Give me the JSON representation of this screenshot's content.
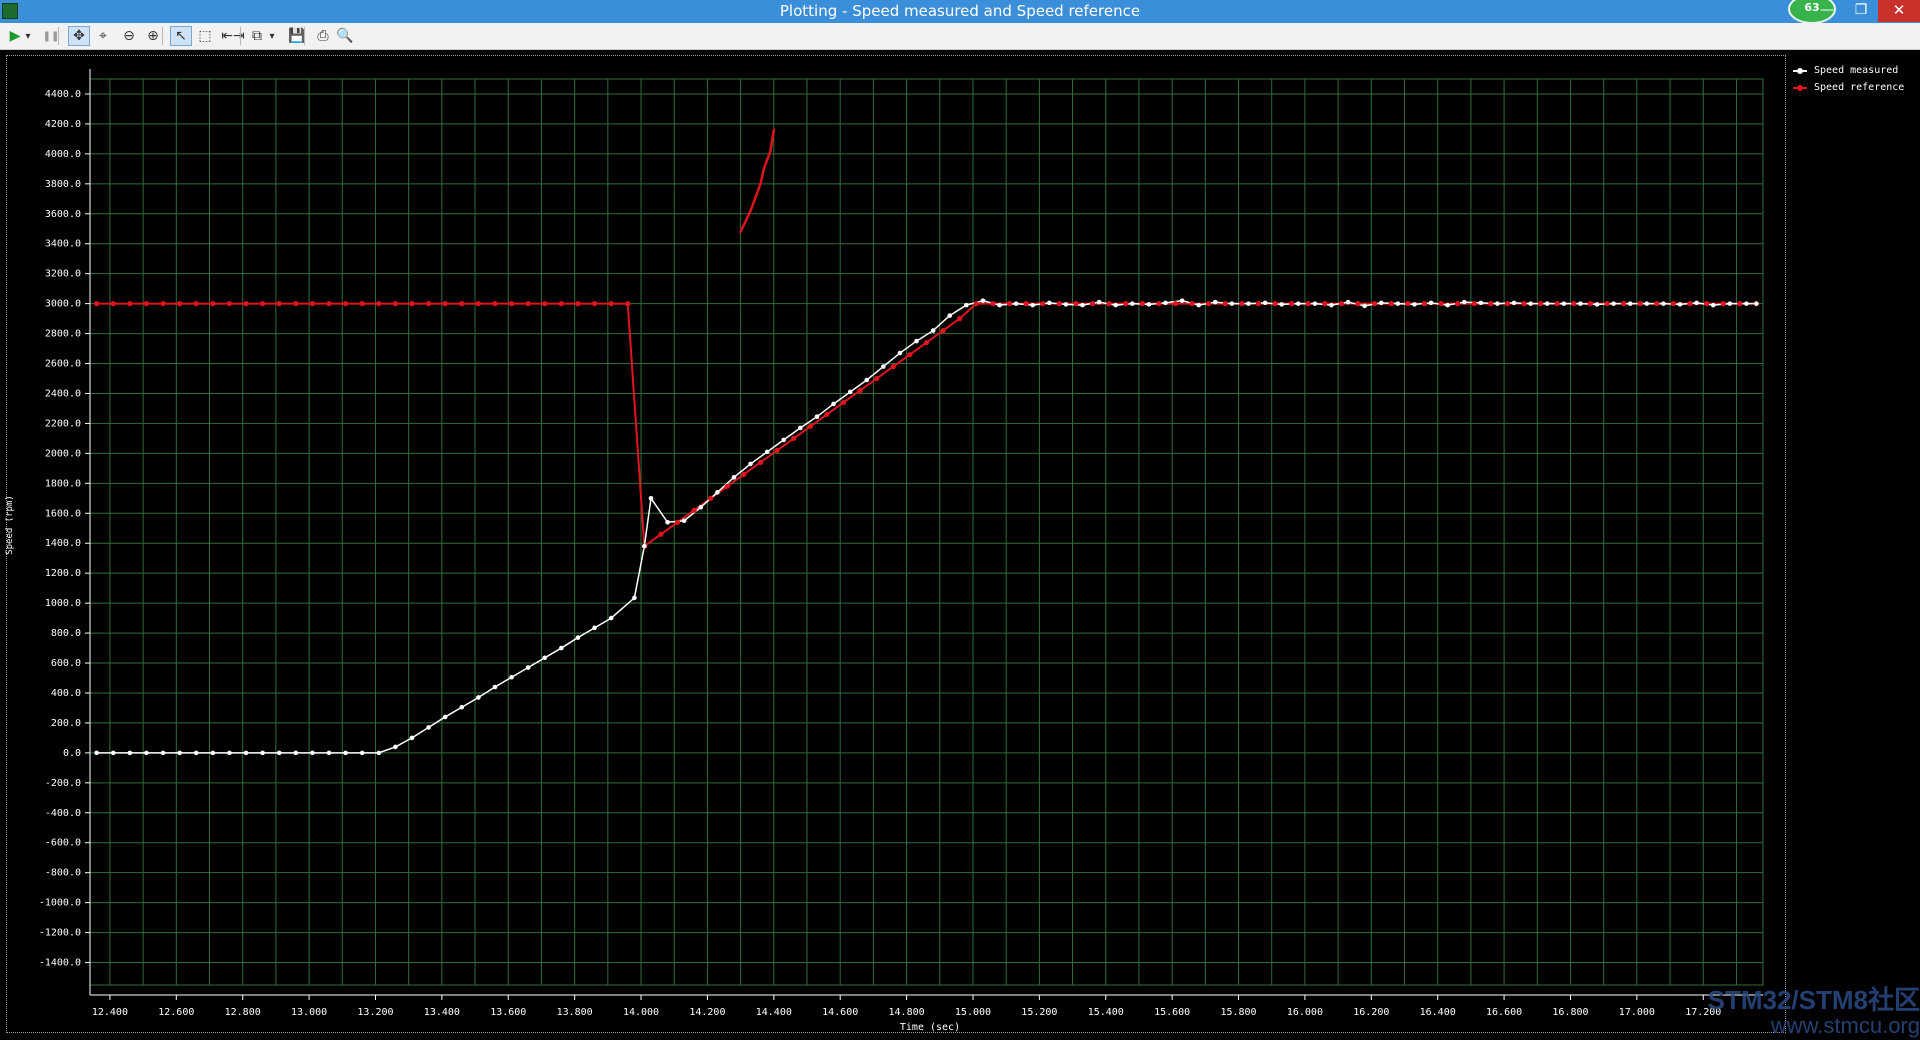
{
  "window": {
    "title": "Plotting  - Speed measured and Speed reference",
    "badge_count": "63",
    "minimize_glyph": "—",
    "maximize_glyph": "❐",
    "close_glyph": "✕"
  },
  "toolbar": {
    "buttons": [
      {
        "name": "run-icon",
        "glyph": "▶"
      },
      {
        "name": "run-dropdown-icon",
        "glyph": "▾"
      },
      {
        "name": "pause-icon",
        "glyph": "❚❚"
      },
      {
        "name": "pan-icon",
        "glyph": "✥"
      },
      {
        "name": "zoom-fit-icon",
        "glyph": "⌖"
      },
      {
        "name": "zoom-out-icon",
        "glyph": "⊖"
      },
      {
        "name": "zoom-in-icon",
        "glyph": "⊕"
      },
      {
        "name": "select-pointer-icon",
        "glyph": "↖"
      },
      {
        "name": "select-rect-icon",
        "glyph": "⬚"
      },
      {
        "name": "cursor-measure-icon",
        "glyph": "⇤⇥"
      },
      {
        "name": "copy-icon",
        "glyph": "⧉"
      },
      {
        "name": "copy-dropdown-icon",
        "glyph": "▾"
      },
      {
        "name": "save-icon",
        "glyph": "💾"
      },
      {
        "name": "print-icon",
        "glyph": "⎙"
      },
      {
        "name": "print-preview-icon",
        "glyph": "🔍"
      }
    ]
  },
  "colors": {
    "measured": "#ffffff",
    "reference": "#e0141e",
    "grid": "#2f6e3a",
    "background": "#000000",
    "axis": "#ffffff"
  },
  "legend": {
    "measured_label": "Speed measured",
    "reference_label": "Speed reference"
  },
  "axes": {
    "x_title": "Time (sec)",
    "y_title": "Speed (rpm)"
  },
  "watermark": {
    "line1": "STM32/STM8社区",
    "line2": "www.stmcu.org"
  },
  "chart_data": {
    "type": "line",
    "xlabel": "Time (sec)",
    "ylabel": "Speed (rpm)",
    "xlim": [
      12.34,
      17.38
    ],
    "ylim": [
      -1550,
      4500
    ],
    "x_ticks": [
      12.4,
      12.6,
      12.8,
      13.0,
      13.2,
      13.4,
      13.6,
      13.8,
      14.0,
      14.2,
      14.4,
      14.6,
      14.8,
      15.0,
      15.2,
      15.4,
      15.6,
      15.8,
      16.0,
      16.2,
      16.4,
      16.6,
      16.8,
      17.0,
      17.2
    ],
    "x_tick_labels": [
      "12.400",
      "12.600",
      "12.800",
      "13.000",
      "13.200",
      "13.400",
      "13.600",
      "13.800",
      "14.000",
      "14.200",
      "14.400",
      "14.600",
      "14.800",
      "15.000",
      "15.200",
      "15.400",
      "15.600",
      "15.800",
      "16.000",
      "16.200",
      "16.400",
      "16.600",
      "16.800",
      "17.000",
      "17.200"
    ],
    "y_ticks": [
      4400,
      4200,
      4000,
      3800,
      3600,
      3400,
      3200,
      3000,
      2800,
      2600,
      2400,
      2200,
      2000,
      1800,
      1600,
      1400,
      1200,
      1000,
      800,
      600,
      400,
      200,
      0,
      -200,
      -400,
      -600,
      -800,
      -1000,
      -1200,
      -1400
    ],
    "y_tick_labels": [
      "4400.0",
      "4200.0",
      "4000.0",
      "3800.0",
      "3600.0",
      "3400.0",
      "3200.0",
      "3000.0",
      "2800.0",
      "2600.0",
      "2400.0",
      "2200.0",
      "2000.0",
      "1800.0",
      "1600.0",
      "1400.0",
      "1200.0",
      "1000.0",
      "800.0",
      "600.0",
      "400.0",
      "200.0",
      "0.0",
      "-200.0",
      "-400.0",
      "-600.0",
      "-800.0",
      "-1000.0",
      "-1200.0",
      "-1400.0"
    ],
    "grid": true,
    "legend_position": "top-right",
    "series": [
      {
        "name": "Speed measured",
        "x": [
          12.36,
          12.41,
          12.46,
          12.51,
          12.56,
          12.61,
          12.66,
          12.71,
          12.76,
          12.81,
          12.86,
          12.91,
          12.96,
          13.01,
          13.06,
          13.11,
          13.16,
          13.21,
          13.26,
          13.31,
          13.36,
          13.41,
          13.46,
          13.51,
          13.56,
          13.61,
          13.66,
          13.71,
          13.76,
          13.81,
          13.86,
          13.91,
          13.98,
          14.01,
          14.03,
          14.08,
          14.13,
          14.18,
          14.23,
          14.28,
          14.33,
          14.38,
          14.43,
          14.48,
          14.53,
          14.58,
          14.63,
          14.68,
          14.73,
          14.78,
          14.83,
          14.88,
          14.93,
          14.98,
          15.03,
          15.08,
          15.13,
          15.18,
          15.23,
          15.28,
          15.33,
          15.38,
          15.43,
          15.48,
          15.53,
          15.58,
          15.63,
          15.68,
          15.73,
          15.78,
          15.83,
          15.88,
          15.93,
          15.98,
          16.03,
          16.08,
          16.13,
          16.18,
          16.23,
          16.28,
          16.33,
          16.38,
          16.43,
          16.48,
          16.53,
          16.58,
          16.63,
          16.68,
          16.73,
          16.78,
          16.83,
          16.88,
          16.93,
          16.98,
          17.03,
          17.08,
          17.13,
          17.18,
          17.23,
          17.28,
          17.33,
          17.36
        ],
        "y": [
          0,
          0,
          0,
          0,
          0,
          0,
          0,
          0,
          0,
          0,
          0,
          0,
          0,
          0,
          0,
          0,
          0,
          0,
          40,
          100,
          170,
          240,
          305,
          370,
          440,
          505,
          570,
          635,
          700,
          770,
          835,
          900,
          1035,
          1380,
          1700,
          1540,
          1550,
          1640,
          1740,
          1840,
          1930,
          2010,
          2090,
          2170,
          2245,
          2330,
          2410,
          2490,
          2580,
          2670,
          2750,
          2820,
          2920,
          2990,
          3020,
          2990,
          3000,
          2990,
          3005,
          2995,
          2990,
          3010,
          2990,
          3000,
          2995,
          3005,
          3020,
          2990,
          3010,
          3000,
          3000,
          3005,
          2995,
          3000,
          3000,
          2990,
          3010,
          2985,
          3005,
          3000,
          2995,
          3005,
          2990,
          3010,
          3005,
          3000,
          3005,
          3000,
          3000,
          3000,
          3000,
          2995,
          3000,
          3000,
          3000,
          3000,
          2995,
          3005,
          2990,
          3000,
          3000,
          3000
        ]
      },
      {
        "name": "Speed reference",
        "x": [
          12.36,
          12.41,
          12.46,
          12.51,
          12.56,
          12.61,
          12.66,
          12.71,
          12.76,
          12.81,
          12.86,
          12.91,
          12.96,
          13.01,
          13.06,
          13.11,
          13.16,
          13.21,
          13.26,
          13.31,
          13.36,
          13.41,
          13.46,
          13.51,
          13.56,
          13.61,
          13.66,
          13.71,
          13.76,
          13.81,
          13.86,
          13.91,
          13.96,
          14.01,
          14.06,
          14.11,
          14.16,
          14.21,
          14.26,
          14.31,
          14.36,
          14.41,
          14.46,
          14.51,
          14.56,
          14.61,
          14.66,
          14.71,
          14.76,
          14.81,
          14.86,
          14.91,
          14.96,
          15.01,
          15.06,
          15.11,
          15.16,
          15.21,
          15.26,
          15.31,
          15.36,
          15.41,
          15.46,
          15.51,
          15.56,
          15.61,
          15.66,
          15.71,
          15.76,
          15.81,
          15.86,
          15.91,
          15.96,
          16.01,
          16.06,
          16.11,
          16.16,
          16.21,
          16.26,
          16.31,
          16.36,
          16.41,
          16.46,
          16.51,
          16.56,
          16.61,
          16.66,
          16.71,
          16.76,
          16.81,
          16.86,
          16.91,
          16.96,
          17.01,
          17.06,
          17.11,
          17.16,
          17.21,
          17.26,
          17.31,
          17.36
        ],
        "y": [
          3000,
          3000,
          3000,
          3000,
          3000,
          3000,
          3000,
          3000,
          3000,
          3000,
          3000,
          3000,
          3000,
          3000,
          3000,
          3000,
          3000,
          3000,
          3000,
          3000,
          3000,
          3000,
          3000,
          3000,
          3000,
          3000,
          3000,
          3000,
          3000,
          3000,
          3000,
          3000,
          3000,
          1380,
          1460,
          1540,
          1620,
          1700,
          1780,
          1860,
          1940,
          2020,
          2100,
          2180,
          2260,
          2340,
          2420,
          2500,
          2580,
          2660,
          2740,
          2820,
          2900,
          3000,
          3000,
          3000,
          3000,
          3000,
          3000,
          3000,
          3000,
          3000,
          3000,
          3000,
          3000,
          3000,
          3000,
          3000,
          3000,
          3000,
          3000,
          3000,
          3000,
          3000,
          3000,
          3000,
          3000,
          3000,
          3000,
          3000,
          3000,
          3000,
          3000,
          3000,
          3000,
          3000,
          3000,
          3000,
          3000,
          3000,
          3000,
          3000,
          3000,
          3000,
          3000,
          3000,
          3000,
          3000,
          3000,
          3000,
          3000
        ]
      }
    ],
    "annotation_stroke": {
      "color": "#e0141e",
      "x": [
        14.3,
        14.33,
        14.36,
        14.37,
        14.39,
        14.4
      ],
      "y": [
        3480,
        3620,
        3800,
        3900,
        4020,
        4160
      ]
    }
  }
}
